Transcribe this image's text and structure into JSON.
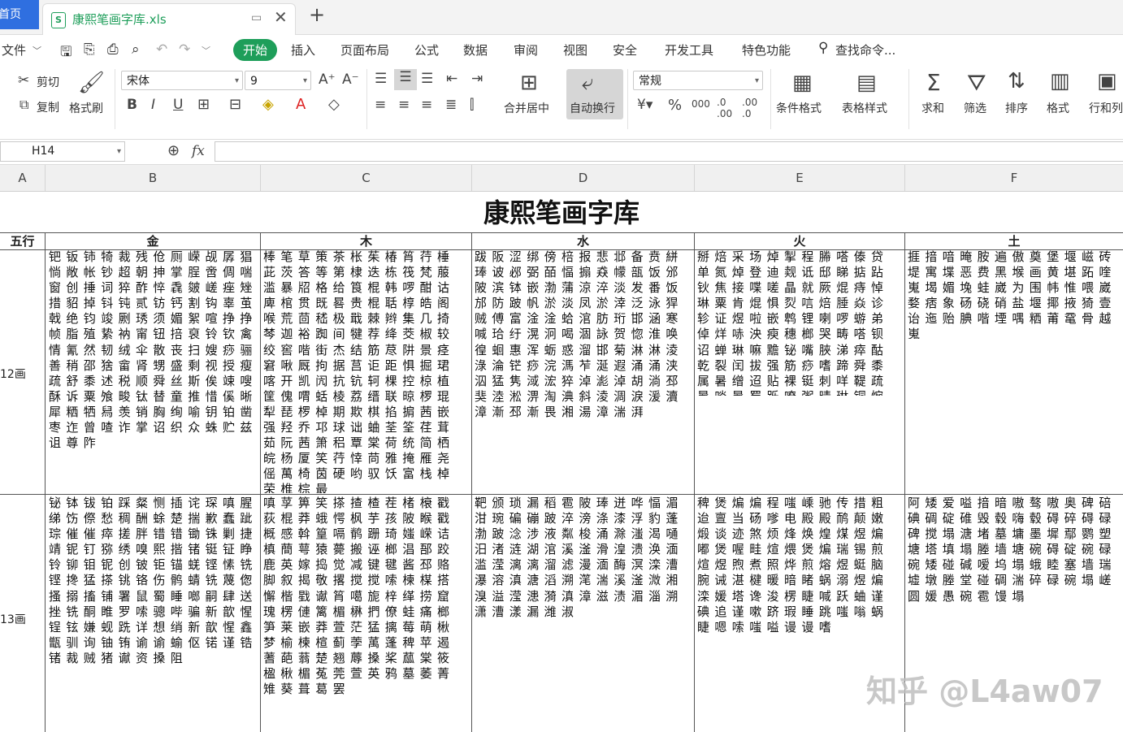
{
  "tabs": {
    "home": "首页",
    "file_name": "康熙笔画字库.xls"
  },
  "menu": {
    "file": "文件",
    "items": [
      "开始",
      "插入",
      "页面布局",
      "公式",
      "数据",
      "审阅",
      "视图",
      "安全",
      "开发工具",
      "特色功能"
    ],
    "search": "查找命令..."
  },
  "ribbon": {
    "cut": "剪切",
    "copy": "复制",
    "format_painter": "格式刷",
    "font_name": "宋体",
    "font_size": "9",
    "merge_center": "合并居中",
    "wrap_text": "自动换行",
    "number_format": "常规",
    "cond_format": "条件格式",
    "table_style": "表格样式",
    "sum": "求和",
    "filter": "筛选",
    "sort": "排序",
    "format": "格式",
    "rowcol": "行和列"
  },
  "formula": {
    "cell_ref": "H14",
    "fx": "fx",
    "content": ""
  },
  "columns": [
    "A",
    "B",
    "C",
    "D",
    "E",
    "F"
  ],
  "sheet": {
    "title": "康熙笔画字库",
    "header_label": "五行",
    "elements": [
      "金",
      "木",
      "水",
      "火",
      "土"
    ],
    "rows": [
      {
        "label": "12画",
        "jin": "钯钣铈犄裁残伧厕嵘觇孱猖惝敞帐钞超朝抻掌脭啻倜喘窗创捶词猝酢悴毳皴嵯痤矬措貂掉钭钝贰钫钙割钩辜茧戟绝钧竣劂琇须媚絮喧挣挣帧脂殖絷衲甯钮掊裒铃钦禽情氰然韧绒伞散丧扫嫂痧骊善稍邵猞畲肾甥盛剩视授瘦疏舒黍述税顺舜丝斯俟竦嗖酥诉粟飧畯钛替童推惜傒晰犀粞牺舄羡销胸绚喻钥铂凿枣迮曾喳诈掌诏织众蛛贮兹诅尊阼",
        "mu": "棒笔草策茶枨茱椿筲荇棰茈茨答等第棣迭栋筏梵菔滥暴牊格给筤棍韩啰酣诂庳棺贯既晷贵棍聒椁皓阁喉荒茴嵇极戢棘辫集几掎棽迦裕踟间犍荐绛茭椒较绞窖喈街杰结筋荩阱景痉窘啾厩拘据莒讵距惧掘珺喀开凯闶抗钪轲棵控椋植筐傀喟蛞棱荔缙联晾椤琨犁琵椤棹期欺棋掐掮茜嵌强羟乔邛球诎蛐荃筌荏茸茹阮茜箫稆覃棠荷统简栖皖杨厦笑荇悻苘雅掩雁尧傜萬椅茵硬哟驭饫富栈棹荣椎棕最",
        "shui": "跋阪涩绑傍棓报悲邶备贲絣琫诐邲弼皕愊搧猋幪瓿饭邠陂滨钵嵌渤蒲涼淬淡发番饭邡防跛帆淤淡凤淤涬泛泳猂贼傅富淦淦蛤涫肪珩邯涵寒喊珨纡滉泂喝涸詠贺惚淮唤徨蛔惠浑蛎惑溜邯菊淋淋淩淥淪铓痧浣溤苲涎遐涌涌浃泅猛隽淢浤猝淖滮淖胡淌邳猆淕淞淠淘淟斜淩淍淚湲瀆漳漸邳漸畏湘湯漳湍湃",
        "huo": "掰焙采场焯掣程幐嗒傣贷单氮焯登迪觌诋邸睇掂跕钬焦接喋嗟晶就厥焜痔悼琳粟肯焜惧烮唁焙腄焱诊轸证煜啦嵌鹎锂喇啰蝣弟倬烊哧泱瘐穗榔哭畴嗒钡诏蝉琳嘛黵铋嘴脥涕瘁酤乾裂闰拔强筋痧嗜蹄舜黍属暑缯迢贴裸铤刺咩鞮疏暑啖暑蜀跞嘹粥晴琳铜惋蹄郾铺寻峨焰渐隐湿铈铁媛蛀螳嵌诊赟粥畲蜒智嵩鼠嗜",
        "tu": "捱揞喑晻胺遍傲奠堡堰嵫砖堤寓堞恶费黑堠画黄堪跖喹嵬堨媚堍蛙崴为围帏惟喂崴婺痞象砀硗硝盐堰揶掖猗壹诒迤贻腆喈堙喁粞莆鼋骨越嵬"
      },
      {
        "label": "13画",
        "jin": "铋钵钹铂踩粲恻插诧琛嗔腥绨饬傺愁稠酬蜍楚揣歉蠢跐琮催催瘁搓胖错错锄铢剿捷靖铌钉猕绣嗅熙揩锗铤钲睁铃铆钼铌创铍钜锚蜣铿愫铣铿搀猛搽铫铬伤鹘蜻铣蔑偬搔搦搐铺署鼠蜀睡啷嗣肆送挫铣酮睢罗嗦骢哔骗新歆惺锃铉嫌蚬跣详想绡新歆惺鑫甑驯询铀铕谕谕蝓伛锘谨锆锗裁贼猪谳资搡阻",
        "mu": "嗔莩箅笑搽揸楂茬楮榱戳荻棍莽蛾愕枫芋孩陂睺戳概感斡篁嗝鹡跚琦媸嵘诘槙蕳萼猿薨搬诬榔淐郚跤鹿英嫁捣觉减键毽酱邳赂脚叙揭敬撂搅搅嗦楝楳搭懈楷戥谳筲噶旎梓缂捞窟瑰楞僆篱楣楙捫僚蛙痛榔笋莱嵌莽萱茫猛摛莓萌楸梦榆楝楦蓟荸萭蓬稗苹遏蓍葩蓊楚翘蓐搡桨蓏棠筱楹楸楣菟莞萱英鸦墓萎菁雉葵葺葛罢",
        "shui": "靶颁琐漏稻雹陂琫迸哗愊湄泔琬碥磞跛淬滂涤漆浮豹蓬渤跛淰涉液粼梭涌滁滍渴嗵汨渚涟湖涫溪滏滑湟溃涣湎滥滢漓漓溜滤漫湎酶溟滦漕瀑溶滇溏滔溯滗湍溪滏溦湘溴溢滢漶漪滇漳滋渍湄淄溯潇漕漾漏潍淑",
        "huo": "稗煲煸煸程嗤嵊驰传措粗迨亶当砀嗲电殿殿鸸颠嫩煅谈迹煞烦烽焕煌煤煜煸嘟煲喔畦煊煨煲煸瑞锡煎煊煜煦煮照烨煎熔煜蜓脑腕诫湛楗暖暗睹蜗溺煜煸滦媛塔谗浚楞睫喊跃蛐谨碘追谨嗽跻瑕睡跳嗤嗡蜗睫嗯嗦嗤嗌谩谩嗜",
        "tu": "阿矮爱嗌揞暗嗷骜嗷奥碑碚碘碉碇碓毁毂嗨毂碍碎碍碌碑搅塌溏堵墓墉墨墀鄢鹦塑塘塔填塌塍墙塘碗碍碇碗碌碗矮碰碱嗳坞塌蛾睦塞墙瑞墟墩塍堂碰碉湍碎碌碗塌嵯圆媛愚碗雹馒塌"
      }
    ]
  }
}
